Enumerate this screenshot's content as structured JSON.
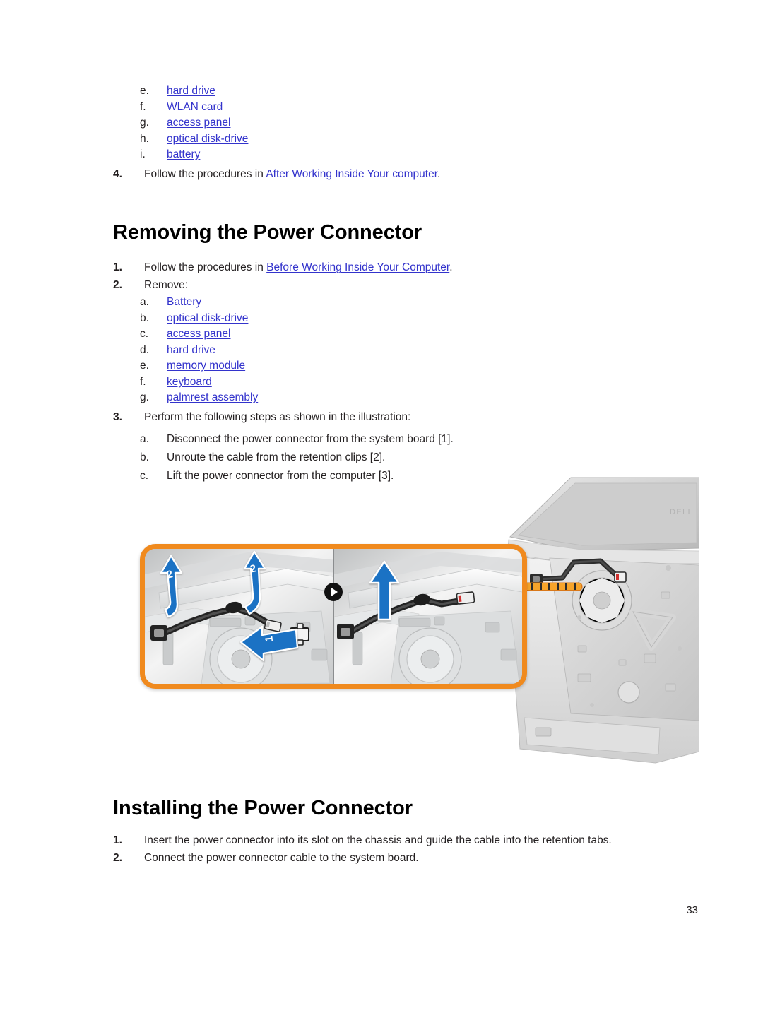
{
  "document": {
    "page_number": "33"
  },
  "top_list": {
    "items": [
      {
        "marker": "e.",
        "link": "hard drive"
      },
      {
        "marker": "f.",
        "link": "WLAN card"
      },
      {
        "marker": "g.",
        "link": "access panel"
      },
      {
        "marker": "h.",
        "link": "optical disk-drive"
      },
      {
        "marker": "i.",
        "link": "battery"
      }
    ],
    "step4": {
      "marker": "4.",
      "text_before": "Follow the procedures in ",
      "link": "After Working Inside Your computer",
      "text_after": "."
    }
  },
  "removing_section": {
    "heading": "Removing the Power Connector",
    "step1": {
      "marker": "1.",
      "text_before": "Follow the procedures in ",
      "link": "Before Working Inside Your Computer",
      "text_after": "."
    },
    "step2": {
      "marker": "2.",
      "text": "Remove:",
      "items": [
        {
          "marker": "a.",
          "link": "Battery"
        },
        {
          "marker": "b.",
          "link": "optical disk-drive"
        },
        {
          "marker": "c.",
          "link": "access panel"
        },
        {
          "marker": "d.",
          "link": "hard drive"
        },
        {
          "marker": "e.",
          "link": "memory module"
        },
        {
          "marker": "f.",
          "link": "keyboard"
        },
        {
          "marker": "g.",
          "link": "palmrest assembly"
        }
      ]
    },
    "step3": {
      "marker": "3.",
      "text": "Perform the following steps as shown in the illustration:",
      "items": [
        {
          "marker": "a.",
          "text": "Disconnect the power connector from the system board [1]."
        },
        {
          "marker": "b.",
          "text": "Unroute the cable from the retention clips [2]."
        },
        {
          "marker": "c.",
          "text": "Lift the power connector from the computer [3]."
        }
      ]
    }
  },
  "figure": {
    "alt": "Exploded view of laptop showing power connector removal",
    "brand_text": "DELL",
    "callout_border_color": "#f08a1e",
    "arrow_color": "#1b72c4",
    "arrows": [
      {
        "id": "left-up-1",
        "label": "2"
      },
      {
        "id": "left-up-2",
        "label": "2"
      },
      {
        "id": "left-disconnect",
        "label": "1"
      },
      {
        "id": "right-lift",
        "label": ""
      }
    ],
    "step_badge": "play-icon"
  },
  "installing_section": {
    "heading": "Installing the Power Connector",
    "steps": [
      {
        "marker": "1.",
        "text": "Insert the power connector into its slot on the chassis and guide the cable into the retention tabs."
      },
      {
        "marker": "2.",
        "text": "Connect the power connector cable to the system board."
      }
    ]
  }
}
